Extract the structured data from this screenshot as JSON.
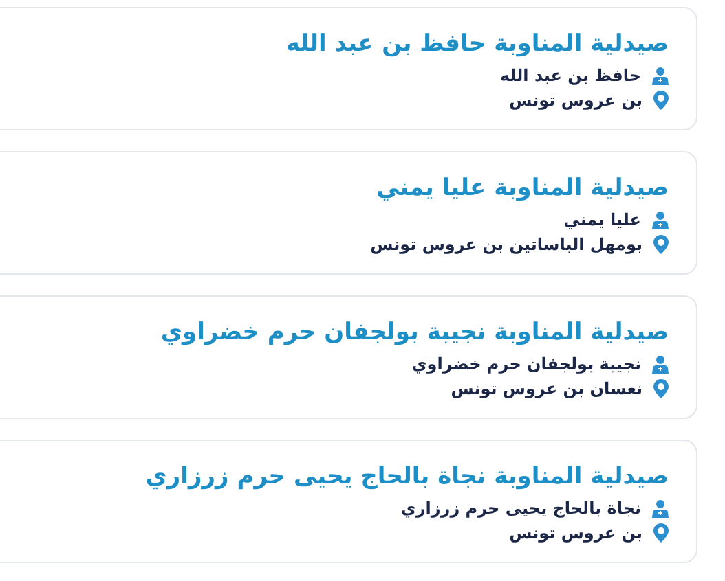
{
  "pharmacies": [
    {
      "title": "صيدلية المناوبة حافظ بن عبد الله",
      "owner": "حافظ بن عبد الله",
      "location": "بن عروس تونس"
    },
    {
      "title": "صيدلية المناوبة عليا يمني",
      "owner": "عليا يمني",
      "location": "بومهل الباساتين بن عروس تونس"
    },
    {
      "title": "صيدلية المناوبة نجيبة بولجفان حرم خضراوي",
      "owner": "نجيبة بولجفان حرم خضراوي",
      "location": "نعسان بن عروس تونس"
    },
    {
      "title": "صيدلية المناوبة نجاة بالحاج يحيى حرم زرزاري",
      "owner": "نجاة بالحاج يحيى حرم زرزاري",
      "location": "بن عروس تونس"
    }
  ]
}
